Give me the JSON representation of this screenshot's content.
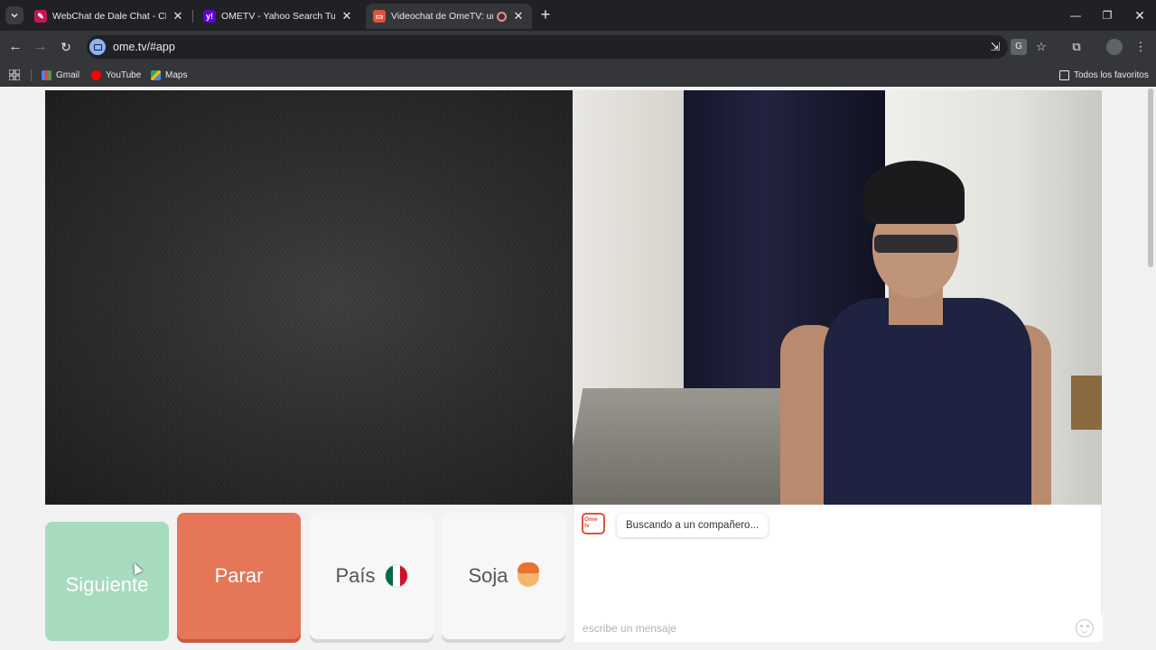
{
  "browser": {
    "tabs": [
      {
        "title": "WebChat de Dale Chat - Chatea",
        "icon": "dalechat-icon",
        "color": "#c2185b",
        "active": false
      },
      {
        "title": "OMETV - Yahoo Search Tus res",
        "icon": "yahoo-icon",
        "color": "#6001d2",
        "active": false
      },
      {
        "title": "Videochat de OmeTV: una a",
        "icon": "ometv-icon",
        "color": "#e0523c",
        "active": true
      }
    ],
    "url": "ome.tv/#app",
    "bookmarks": [
      {
        "label": "Gmail",
        "icon": "gmail-icon"
      },
      {
        "label": "YouTube",
        "icon": "youtube-icon"
      },
      {
        "label": "Maps",
        "icon": "maps-icon"
      }
    ],
    "all_bookmarks": "Todos los favoritos"
  },
  "controls": {
    "next": "Siguiente",
    "stop": "Parar",
    "country": "País",
    "gender": "Soja"
  },
  "chat": {
    "status": "Buscando a un compañero...",
    "logo_text": "Ome tv",
    "placeholder": "escribe un mensaje"
  }
}
